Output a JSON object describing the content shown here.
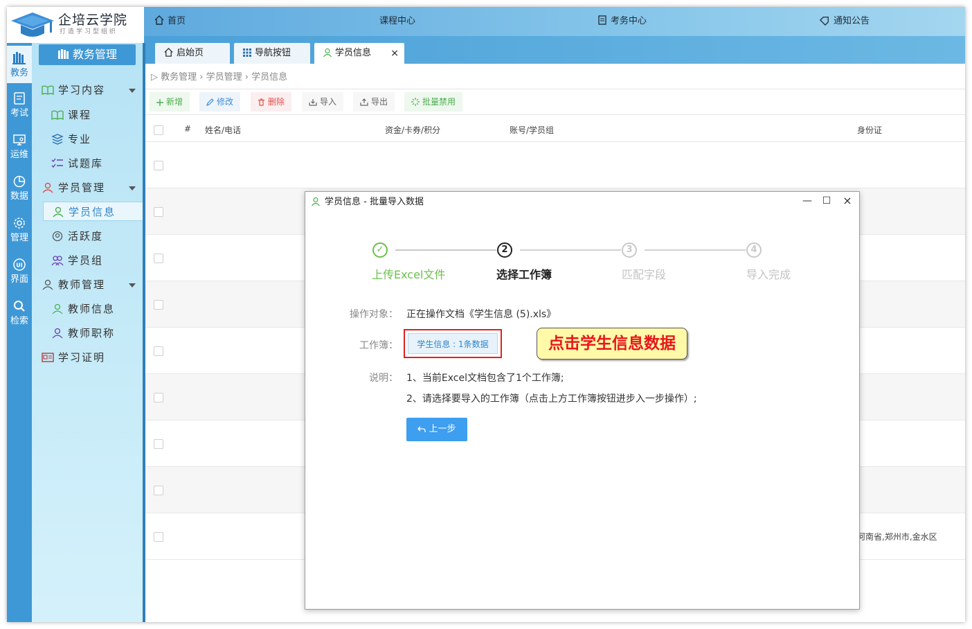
{
  "brand": {
    "name": "企培云学院",
    "slogan": "打造学习型组织"
  },
  "topnav": [
    {
      "label": "首页",
      "icon": "home-icon"
    },
    {
      "label": "课程中心"
    },
    {
      "label": "考务中心",
      "icon": "document-icon"
    },
    {
      "label": "通知公告",
      "icon": "tag-icon"
    }
  ],
  "tabs": [
    {
      "label": "启始页",
      "icon": "home-icon"
    },
    {
      "label": "导航按钮",
      "icon": "grid-icon"
    },
    {
      "label": "学员信息",
      "icon": "user-icon",
      "close": "×"
    }
  ],
  "rail": [
    {
      "label": "教务",
      "icon": "books-icon",
      "active": true
    },
    {
      "label": "考试",
      "icon": "exam-icon"
    },
    {
      "label": "运维",
      "icon": "monitor-icon"
    },
    {
      "label": "数据",
      "icon": "pie-icon"
    },
    {
      "label": "管理",
      "icon": "gear-icon"
    },
    {
      "label": "界面",
      "icon": "ui-icon"
    },
    {
      "label": "检索",
      "icon": "search-icon"
    }
  ],
  "menu": {
    "title": "教务管理",
    "items": [
      {
        "label": "学习内容",
        "icon": "book-open-icon",
        "level": 1,
        "caret": true
      },
      {
        "label": "课程",
        "icon": "book-open-icon",
        "level": 2
      },
      {
        "label": "专业",
        "icon": "layers-icon",
        "level": 2
      },
      {
        "label": "试题库",
        "icon": "checklist-icon",
        "level": 2
      },
      {
        "label": "学员管理",
        "icon": "user-icon",
        "level": 1,
        "caret": true
      },
      {
        "label": "学员信息",
        "icon": "user-icon",
        "level": 2,
        "active": true
      },
      {
        "label": "活跃度",
        "icon": "badge-icon",
        "level": 2
      },
      {
        "label": "学员组",
        "icon": "users-icon",
        "level": 2
      },
      {
        "label": "教师管理",
        "icon": "teacher-icon",
        "level": 1,
        "caret": true
      },
      {
        "label": "教师信息",
        "icon": "teacher-icon",
        "level": 2
      },
      {
        "label": "教师职称",
        "icon": "teacher-icon",
        "level": 2
      },
      {
        "label": "学习证明",
        "icon": "certificate-icon",
        "level": 1
      }
    ]
  },
  "breadcrumb": "教务管理 › 学员管理 › 学员信息",
  "toolbar": [
    {
      "label": "新增",
      "icon": "plus-icon",
      "color": "#4caf50",
      "bg": "#eef8ee"
    },
    {
      "label": "修改",
      "icon": "edit-icon",
      "color": "#3d8fd8",
      "bg": "#eef4fb"
    },
    {
      "label": "删除",
      "icon": "trash-icon",
      "color": "#e05050",
      "bg": "#fbeeee"
    },
    {
      "label": "导入",
      "icon": "import-icon",
      "color": "#666666",
      "bg": "#f4f4f4"
    },
    {
      "label": "导出",
      "icon": "export-icon",
      "color": "#666666",
      "bg": "#f4f4f4"
    },
    {
      "label": "批量禁用",
      "icon": "disable-icon",
      "color": "#4caf50",
      "bg": "#eef8ee"
    }
  ],
  "grid": {
    "columns": [
      "#",
      "姓名/电话",
      "资金/卡券/积分",
      "账号/学员组",
      "身份证"
    ],
    "visible_cell": "河南省,郑州市,金水区"
  },
  "modal": {
    "title": "学员信息 - 批量导入数据",
    "controls": {
      "minimize": "—",
      "maximize": "☐",
      "close": "×"
    },
    "steps": [
      {
        "num": "✓",
        "label": "上传Excel文件",
        "state": "done"
      },
      {
        "num": "2",
        "label": "选择工作簿",
        "state": "current"
      },
      {
        "num": "3",
        "label": "匹配字段",
        "state": "pending"
      },
      {
        "num": "4",
        "label": "导入完成",
        "state": "pending"
      }
    ],
    "target_label": "操作对象：",
    "target_value": "正在操作文档《学生信息 (5).xls》",
    "sheet_label": "工作簿：",
    "sheet_button": "学生信息 : 1条数据",
    "callout": "点击学生信息数据",
    "note_label": "说明：",
    "notes": [
      "1、当前Excel文档包含了1个工作簿;",
      "2、请选择要导入的工作簿（点击上方工作簿按钮进步入一步操作）;"
    ],
    "prev_button": "上一步"
  },
  "colors": {
    "accent": "#3f98d6",
    "done": "#6abf4b",
    "callout_text": "#e8161c"
  }
}
